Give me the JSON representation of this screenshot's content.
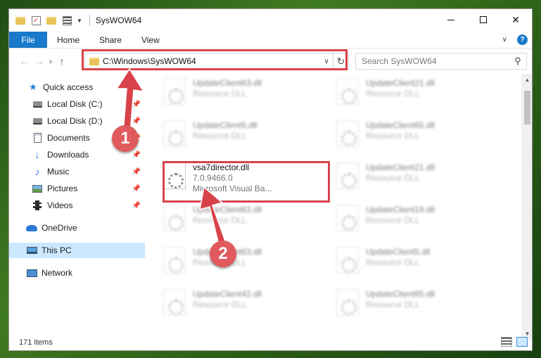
{
  "window": {
    "title": "SysWOW64",
    "controls": {
      "minimize": "",
      "maximize": "",
      "close": "✕"
    }
  },
  "ribbon": {
    "file": "File",
    "tabs": [
      "Home",
      "Share",
      "View"
    ]
  },
  "address_bar": {
    "path": "C:\\Windows\\SysWOW64",
    "search_placeholder": "Search SysWOW64"
  },
  "sidebar": {
    "items": [
      {
        "label": "Quick access",
        "icon": "star-icon",
        "pinned": false
      },
      {
        "label": "Local Disk (C:)",
        "icon": "disk-icon",
        "pinned": true
      },
      {
        "label": "Local Disk (D:)",
        "icon": "disk-icon",
        "pinned": true
      },
      {
        "label": "Documents",
        "icon": "documents-icon",
        "pinned": true
      },
      {
        "label": "Downloads",
        "icon": "downloads-icon",
        "pinned": true
      },
      {
        "label": "Music",
        "icon": "music-icon",
        "pinned": true
      },
      {
        "label": "Pictures",
        "icon": "pictures-icon",
        "pinned": true
      },
      {
        "label": "Videos",
        "icon": "videos-icon",
        "pinned": true
      },
      {
        "label": "OneDrive",
        "icon": "cloud-icon",
        "pinned": false
      },
      {
        "label": "This PC",
        "icon": "pc-icon",
        "pinned": false,
        "selected": true
      },
      {
        "label": "Network",
        "icon": "network-icon",
        "pinned": false
      }
    ]
  },
  "files": {
    "left_column": [
      {
        "name": "UpdateClient63.dll",
        "type": "Resource DLL",
        "blurred": true
      },
      {
        "name": "UpdateClient5.dll",
        "type": "Resource DLL",
        "blurred": true
      },
      {
        "name": "vsa7director.dll",
        "version": "7.0.9466.0",
        "company": "Microsoft Visual Ba...",
        "blurred": false
      },
      {
        "name": "UpdateClient63.dll",
        "type": "Resource DLL",
        "blurred": true
      },
      {
        "name": "UpdateClient63.dll",
        "type": "Resource DLL",
        "blurred": true
      },
      {
        "name": "UpdateClient42.dll",
        "type": "Resource DLL",
        "blurred": true
      }
    ],
    "right_column": [
      {
        "name": "UpdateClient21.dll",
        "type": "Resource DLL",
        "blurred": true
      },
      {
        "name": "UpdateClient65.dll",
        "type": "Resource DLL",
        "blurred": true
      },
      {
        "name": "UpdateClient21.dll",
        "type": "Resource DLL",
        "blurred": true
      },
      {
        "name": "UpdateClient19.dll",
        "type": "Resource DLL",
        "blurred": true
      },
      {
        "name": "UpdateClient5.dll",
        "type": "Resource DLL",
        "blurred": true
      },
      {
        "name": "UpdateClient65.dll",
        "type": "Resource DLL",
        "blurred": true
      }
    ]
  },
  "status_bar": {
    "item_count": "171 items"
  },
  "annotations": {
    "step1": "1",
    "step2": "2",
    "color": "#d8434a"
  },
  "colors": {
    "accent": "#1979ca",
    "selected": "#cce8ff",
    "annotation": "#d8434a"
  }
}
